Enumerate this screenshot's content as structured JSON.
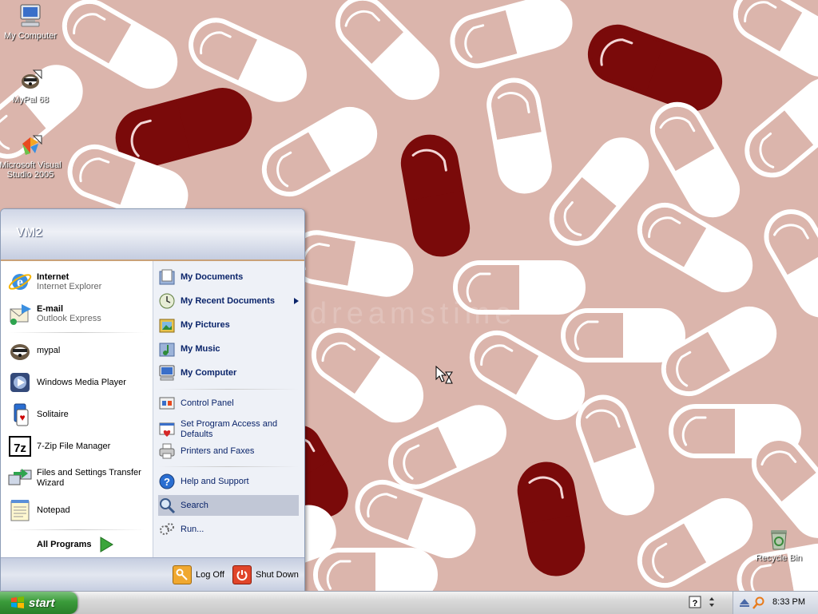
{
  "desktop": {
    "icons": [
      {
        "label": "My Computer",
        "icon": "computer-icon"
      },
      {
        "label": "MyPal 68",
        "icon": "mypal-icon"
      },
      {
        "label": "Microsoft Visual Studio 2005",
        "icon": "visual-studio-icon"
      },
      {
        "label": "Recycle Bin",
        "icon": "recycle-bin-icon"
      }
    ],
    "watermark": "dreamstime",
    "colors": {
      "background": "#dbb5ac",
      "pill_red": "#7a0a0a",
      "pill_white": "#ffffff"
    }
  },
  "start_menu": {
    "user_name": "VM2",
    "pinned": [
      {
        "title": "Internet",
        "subtitle": "Internet Explorer",
        "icon": "internet-explorer-icon"
      },
      {
        "title": "E-mail",
        "subtitle": "Outlook Express",
        "icon": "outlook-express-icon"
      }
    ],
    "recent": [
      {
        "label": "mypal",
        "icon": "mypal-icon"
      },
      {
        "label": "Windows Media Player",
        "icon": "media-player-icon"
      },
      {
        "label": "Solitaire",
        "icon": "solitaire-icon"
      },
      {
        "label": "7-Zip File Manager",
        "icon": "7zip-icon"
      },
      {
        "label": "Files and Settings Transfer Wizard",
        "icon": "transfer-wizard-icon"
      },
      {
        "label": "Notepad",
        "icon": "notepad-icon"
      }
    ],
    "all_programs": "All Programs",
    "places": [
      {
        "label": "My Documents",
        "icon": "documents-icon"
      },
      {
        "label": "My Recent Documents",
        "icon": "recent-documents-icon"
      },
      {
        "label": "My Pictures",
        "icon": "pictures-icon"
      },
      {
        "label": "My Music",
        "icon": "music-icon"
      },
      {
        "label": "My Computer",
        "icon": "computer-icon"
      }
    ],
    "system": [
      {
        "label": "Control Panel",
        "icon": "control-panel-icon"
      },
      {
        "label": "Set Program Access and Defaults",
        "icon": "program-access-icon"
      },
      {
        "label": "Printers and Faxes",
        "icon": "printer-icon"
      }
    ],
    "help": [
      {
        "label": "Help and Support",
        "icon": "help-icon"
      },
      {
        "label": "Search",
        "icon": "search-icon"
      },
      {
        "label": "Run...",
        "icon": "run-icon"
      }
    ],
    "footer": {
      "log_off": "Log Off",
      "shut_down": "Shut Down"
    }
  },
  "taskbar": {
    "start_label": "start",
    "clock": "8:33 PM",
    "colors": {
      "start_green": "#3a9b3a"
    }
  }
}
